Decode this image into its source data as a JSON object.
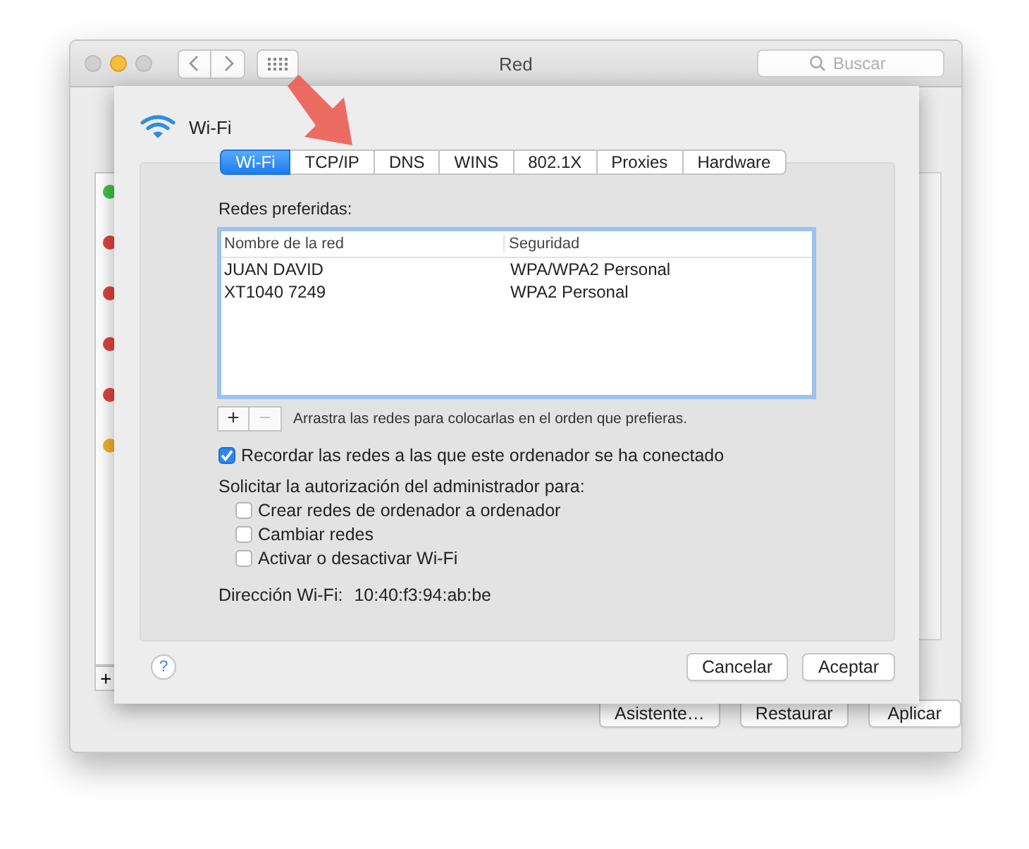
{
  "window": {
    "title": "Red",
    "search": {
      "placeholder": "Buscar"
    }
  },
  "services": [
    {
      "color": "#3cc24a"
    },
    {
      "color": "#e0443e"
    },
    {
      "color": "#e0443e"
    },
    {
      "color": "#e0443e"
    },
    {
      "color": "#e0443e"
    },
    {
      "color": "#f0b429"
    }
  ],
  "services_add": "+",
  "footer_buttons": [
    "Asistente…",
    "Restaurar",
    "Aplicar"
  ],
  "sheet": {
    "title": "Wi-Fi",
    "tabs": [
      {
        "label": "Wi-Fi",
        "selected": true
      },
      {
        "label": "TCP/IP",
        "selected": false
      },
      {
        "label": "DNS",
        "selected": false
      },
      {
        "label": "WINS",
        "selected": false
      },
      {
        "label": "802.1X",
        "selected": false
      },
      {
        "label": "Proxies",
        "selected": false
      },
      {
        "label": "Hardware",
        "selected": false
      }
    ],
    "preferred_label": "Redes preferidas:",
    "table": {
      "columns": [
        "Nombre de la red",
        "Seguridad"
      ],
      "rows": [
        [
          "JUAN DAVID",
          "WPA/WPA2 Personal"
        ],
        [
          "XT1040 7249",
          "WPA2 Personal"
        ]
      ]
    },
    "add": {
      "label": "+",
      "disabled": false
    },
    "remove": {
      "label": "−",
      "disabled": true
    },
    "hint": "Arrastra las redes para colocarlas en el orden que prefieras.",
    "remember": {
      "label": "Recordar las redes a las que este ordenador se ha conectado",
      "checked": true
    },
    "admin_label": "Solicitar la autorización del administrador para:",
    "admin_options": [
      {
        "label": "Crear redes de ordenador a ordenador",
        "checked": false
      },
      {
        "label": "Cambiar redes",
        "checked": false
      },
      {
        "label": "Activar o desactivar Wi-Fi",
        "checked": false
      }
    ],
    "address_label": "Dirección Wi-Fi:",
    "address": "10:40:f3:94:ab:be",
    "help": "?",
    "buttons": [
      "Cancelar",
      "Aceptar"
    ]
  }
}
